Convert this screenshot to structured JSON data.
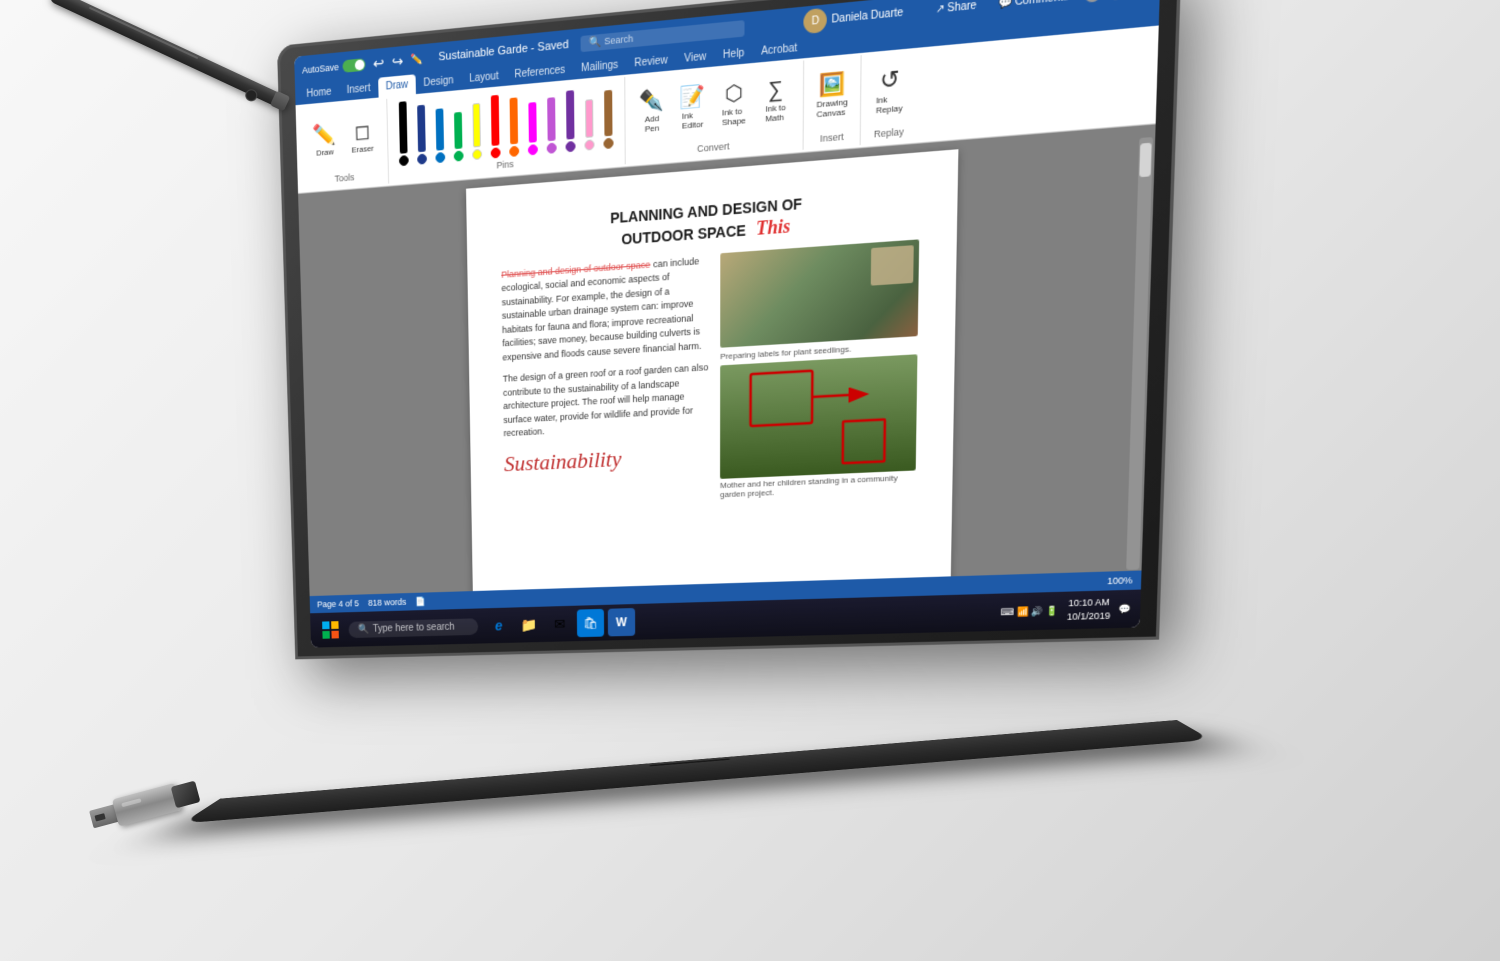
{
  "background": "#e8e8e8",
  "laptop": {
    "color": "#2d2d2d"
  },
  "word": {
    "titlebar": {
      "autosave_label": "AutoSave",
      "title": "Sustainable Garde - Saved",
      "search_placeholder": "Search",
      "user_name": "Daniela Duarte",
      "share_label": "Share",
      "comments_label": "Comments"
    },
    "ribbon": {
      "tabs": [
        "Home",
        "Insert",
        "Draw",
        "Design",
        "Layout",
        "References",
        "Mailings",
        "Review",
        "View",
        "Help",
        "Acrobat"
      ],
      "active_tab": "Draw",
      "groups": {
        "tools": {
          "label": "Tools",
          "items": [
            "Draw",
            "Eraser"
          ]
        },
        "pins": {
          "label": "Pins",
          "colors": [
            "#000000",
            "#1e5aa8",
            "#0070c0",
            "#00b050",
            "#ffff00",
            "#ff0000",
            "#ff6600",
            "#ff00ff",
            "#c055d4",
            "#7030a0",
            "#ff99cc",
            "#996633"
          ]
        },
        "convert": {
          "label": "Convert",
          "items": [
            "Add Pen",
            "Ink Editor",
            "Ink to Shape",
            "Ink to Math"
          ]
        },
        "insert": {
          "label": "Insert",
          "items": [
            "Drawing Canvas"
          ]
        },
        "replay": {
          "label": "Replay",
          "items": [
            "Ink Replay"
          ]
        }
      }
    },
    "document": {
      "title_line1": "PLANNING AND DESIGN OF",
      "title_line2": "OUTDOOR SPACE",
      "title_handwrite": "This",
      "para1_strikethrough": "Planning and design of outdoor space",
      "para1_cont": " can include ecological, social and economic aspects of sustainability. For example, the design of a sustainable urban drainage system can: improve habitats for fauna and flora; improve recreational facilities; save money, because building culverts is expensive and floods cause severe financial harm.",
      "para2": "The design of a green roof or a roof garden can also contribute to the sustainability of a landscape architecture project. The roof will help manage surface water, provide for wildlife and provide for recreation.",
      "image1_caption": "Preparing labels for plant seedlings.",
      "image2_caption": "Mother and her children standing in a community garden project.",
      "handwrite_word": "Sustainability",
      "page_info": "Page 4 of 5",
      "word_count": "818 words"
    }
  },
  "taskbar": {
    "search_placeholder": "Type here to search",
    "time": "10:10 AM",
    "date": "10/1/2019"
  },
  "status_bar": {
    "page": "Page 4 of 5",
    "words": "818 words",
    "zoom": "100%"
  },
  "icons": {
    "windows_logo": "⊞",
    "search": "🔍",
    "edge": "e",
    "folder": "📁",
    "mail": "✉",
    "store": "🛍",
    "word": "W"
  }
}
